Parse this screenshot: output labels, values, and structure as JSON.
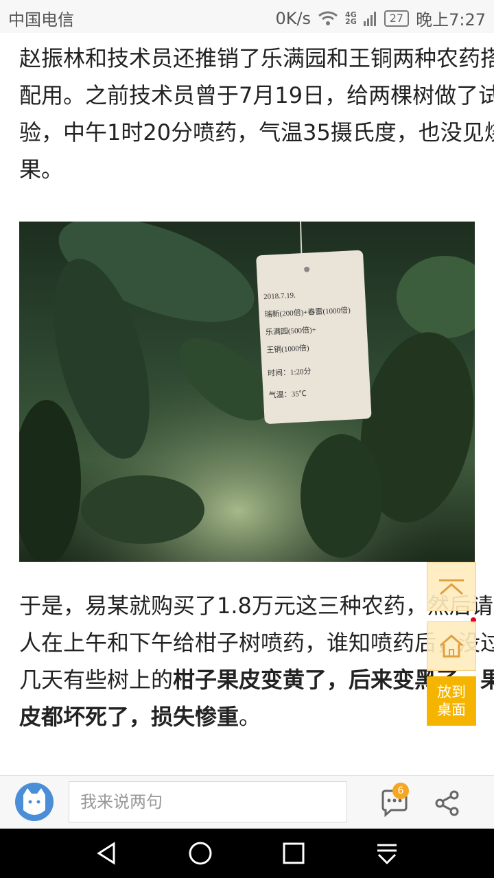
{
  "status_bar": {
    "carrier": "中国电信",
    "speed": "0K/s",
    "net_top": "4G",
    "net_bottom": "2G",
    "battery": "27",
    "time": "晚上7:27"
  },
  "article": {
    "para1": "赵振林和技术员还推销了乐满园和王铜两种农药搭配用。之前技术员曾于7月19日，给两棵树做了试验，中午1时20分喷药，气温35摄氏度，也没见烧果。",
    "photo_tag_lines": [
      "2018.7.19.",
      "瑞新(200倍)+春雷(1000倍)",
      "乐满园(500倍)+",
      "王铜(1000倍)",
      "时间：1:20分",
      "气温：35℃"
    ],
    "para2_normal": "于是，易某就购买了1.8万元这三种农药，然后请人在上午和下午给柑子树喷药，谁知喷药后，没过几天有些树上的",
    "para2_bold": "柑子果皮变黄了，后来变黑了，果皮都坏死了，损失惨重",
    "para2_end": "。"
  },
  "floating": {
    "desktop_label_1": "放到",
    "desktop_label_2": "桌面"
  },
  "bottom_bar": {
    "comment_placeholder": "我来说两句",
    "comment_count": "6"
  },
  "colors": {
    "accent_orange": "#f5a623",
    "desktop_button": "#f5b400",
    "avatar_blue": "#4a8ed8"
  }
}
